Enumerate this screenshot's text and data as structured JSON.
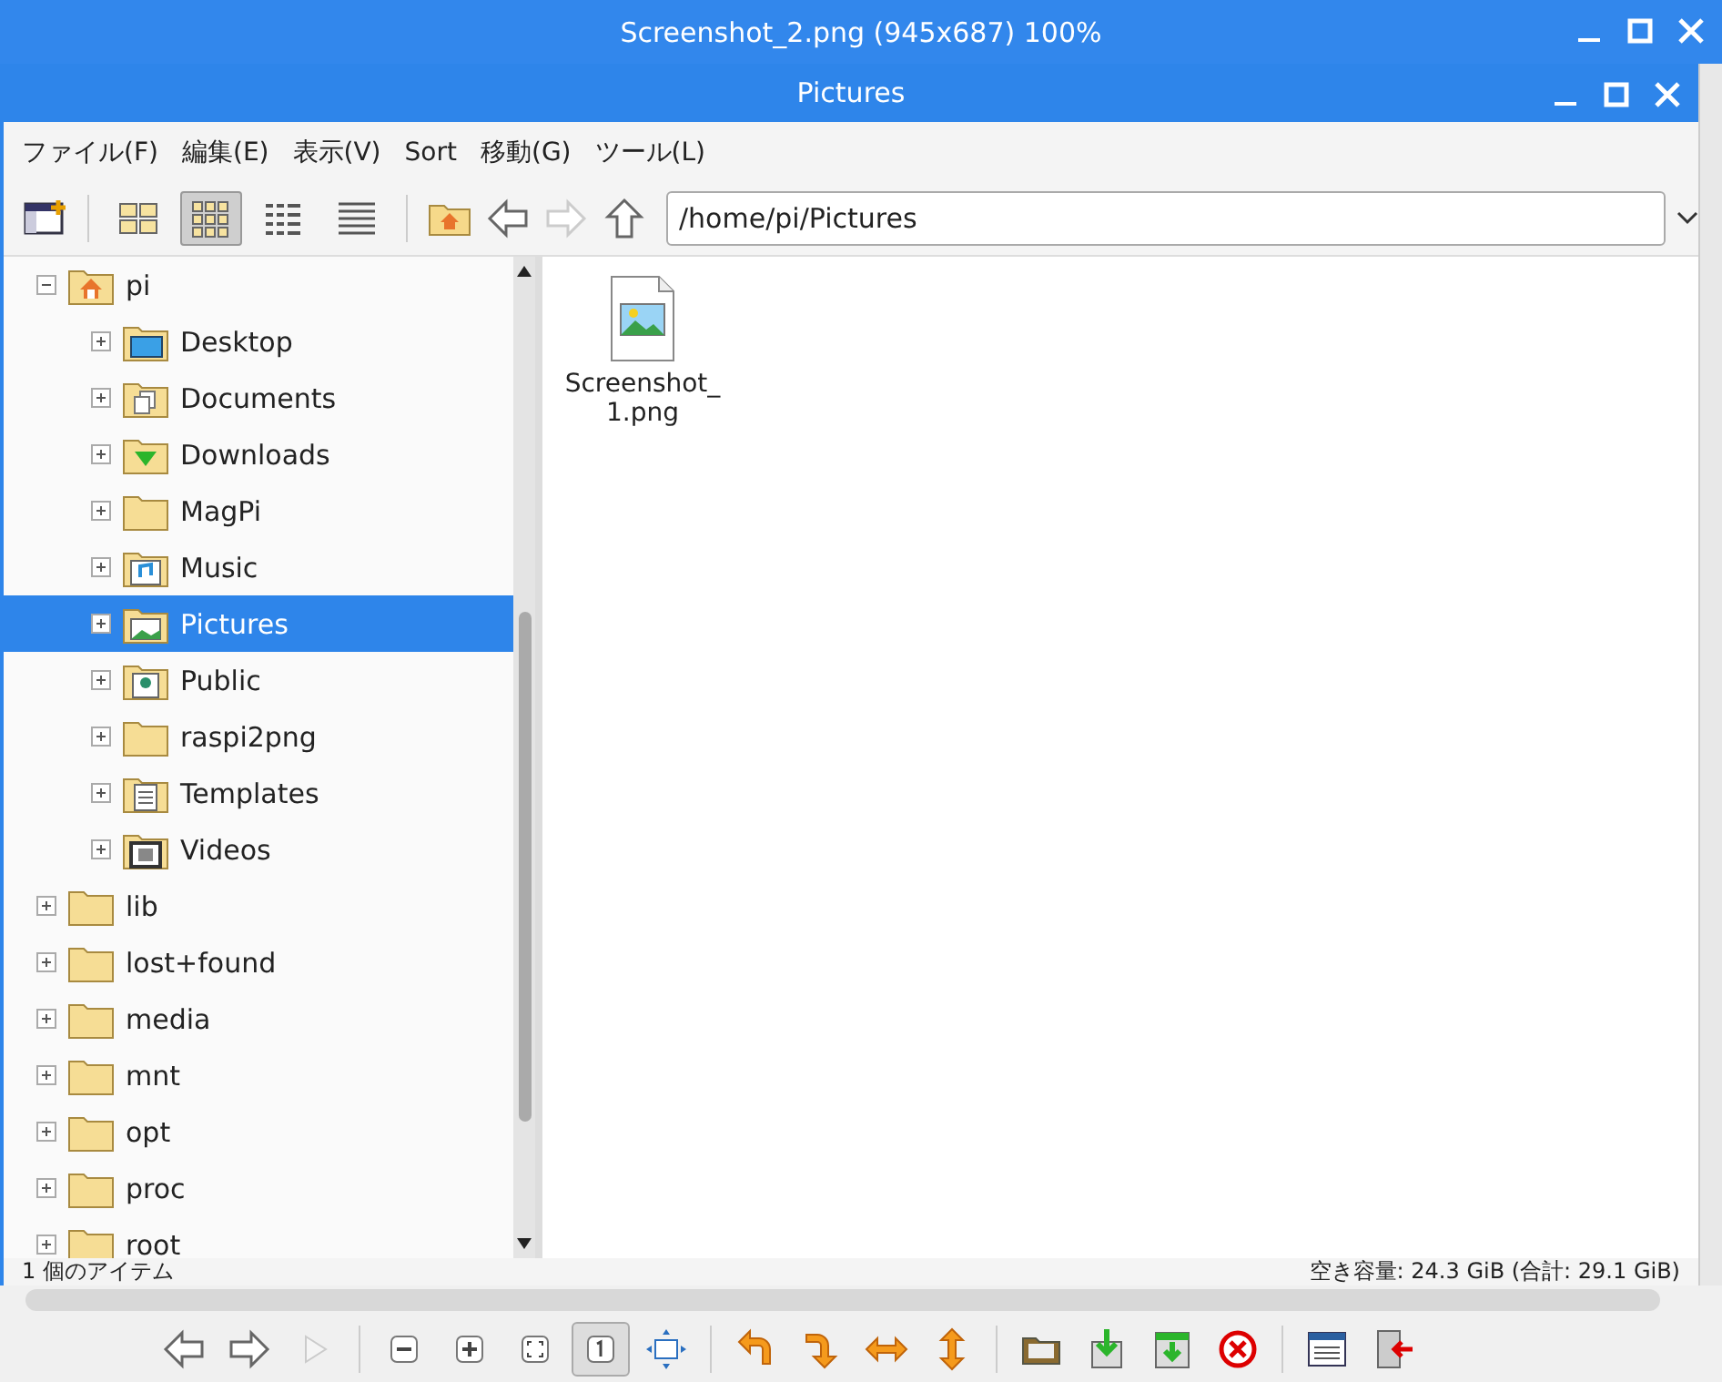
{
  "viewer_window": {
    "title": "Screenshot_2.png (945x687) 100%"
  },
  "window": {
    "title": "Pictures"
  },
  "menu": [
    "ファイル(F)",
    "編集(E)",
    "表示(V)",
    "Sort",
    "移動(G)",
    "ツール(L)"
  ],
  "view_modes": [
    {
      "kind": "icons",
      "selected": false
    },
    {
      "kind": "thumbnails",
      "selected": true
    },
    {
      "kind": "compact",
      "selected": false
    },
    {
      "kind": "list",
      "selected": false
    }
  ],
  "nav_buttons": [
    {
      "kind": "back",
      "disabled": false
    },
    {
      "kind": "forward",
      "disabled": true
    },
    {
      "kind": "up",
      "disabled": false
    }
  ],
  "path": {
    "value": "/home/pi/Pictures"
  },
  "tree": [
    {
      "label": "pi",
      "kind": "home",
      "expanded": true,
      "selected": false,
      "children": [
        {
          "label": "Desktop",
          "kind": "desktop",
          "expanded": false,
          "selected": false
        },
        {
          "label": "Documents",
          "kind": "documents",
          "expanded": false,
          "selected": false
        },
        {
          "label": "Downloads",
          "kind": "downloads",
          "expanded": false,
          "selected": false
        },
        {
          "label": "MagPi",
          "kind": "folder",
          "expanded": false,
          "selected": false
        },
        {
          "label": "Music",
          "kind": "music",
          "expanded": false,
          "selected": false
        },
        {
          "label": "Pictures",
          "kind": "pictures",
          "expanded": false,
          "selected": true
        },
        {
          "label": "Public",
          "kind": "public",
          "expanded": false,
          "selected": false
        },
        {
          "label": "raspi2png",
          "kind": "folder",
          "expanded": false,
          "selected": false
        },
        {
          "label": "Templates",
          "kind": "templates",
          "expanded": false,
          "selected": false
        },
        {
          "label": "Videos",
          "kind": "videos",
          "expanded": false,
          "selected": false
        }
      ]
    },
    {
      "label": "lib",
      "kind": "folder",
      "expanded": false,
      "selected": false
    },
    {
      "label": "lost+found",
      "kind": "folder",
      "expanded": false,
      "selected": false
    },
    {
      "label": "media",
      "kind": "folder",
      "expanded": false,
      "selected": false
    },
    {
      "label": "mnt",
      "kind": "folder",
      "expanded": false,
      "selected": false
    },
    {
      "label": "opt",
      "kind": "folder",
      "expanded": false,
      "selected": false
    },
    {
      "label": "proc",
      "kind": "folder",
      "expanded": false,
      "selected": false
    },
    {
      "label": "root",
      "kind": "folder",
      "expanded": false,
      "selected": false
    }
  ],
  "files": [
    {
      "name": "Screenshot_\n1.png"
    }
  ],
  "status_bar": {
    "items": "1 個のアイテム",
    "free_space": "空き容量: 24.3 GiB (合計: 29.1 GiB)"
  },
  "viewer_toolbar": [
    {
      "kind": "back",
      "selected": false,
      "disabled": false
    },
    {
      "kind": "forward",
      "selected": false,
      "disabled": false
    },
    {
      "kind": "play",
      "selected": false,
      "disabled": true
    },
    {
      "kind": "zoom-out",
      "selected": false,
      "disabled": false
    },
    {
      "kind": "zoom-in",
      "selected": false,
      "disabled": false
    },
    {
      "kind": "fit",
      "selected": false,
      "disabled": false
    },
    {
      "kind": "actual",
      "selected": true,
      "disabled": false
    },
    {
      "kind": "fullscreen",
      "selected": false,
      "disabled": false
    },
    {
      "kind": "rotate-left",
      "selected": false,
      "disabled": false
    },
    {
      "kind": "rotate-right",
      "selected": false,
      "disabled": false
    },
    {
      "kind": "flip-h",
      "selected": false,
      "disabled": false
    },
    {
      "kind": "flip-v",
      "selected": false,
      "disabled": false
    },
    {
      "kind": "open",
      "selected": false,
      "disabled": false
    },
    {
      "kind": "save",
      "selected": false,
      "disabled": false
    },
    {
      "kind": "save-as",
      "selected": false,
      "disabled": false
    },
    {
      "kind": "delete",
      "selected": false,
      "disabled": false
    },
    {
      "kind": "preferences",
      "selected": false,
      "disabled": false
    },
    {
      "kind": "exit",
      "selected": false,
      "disabled": false
    }
  ]
}
